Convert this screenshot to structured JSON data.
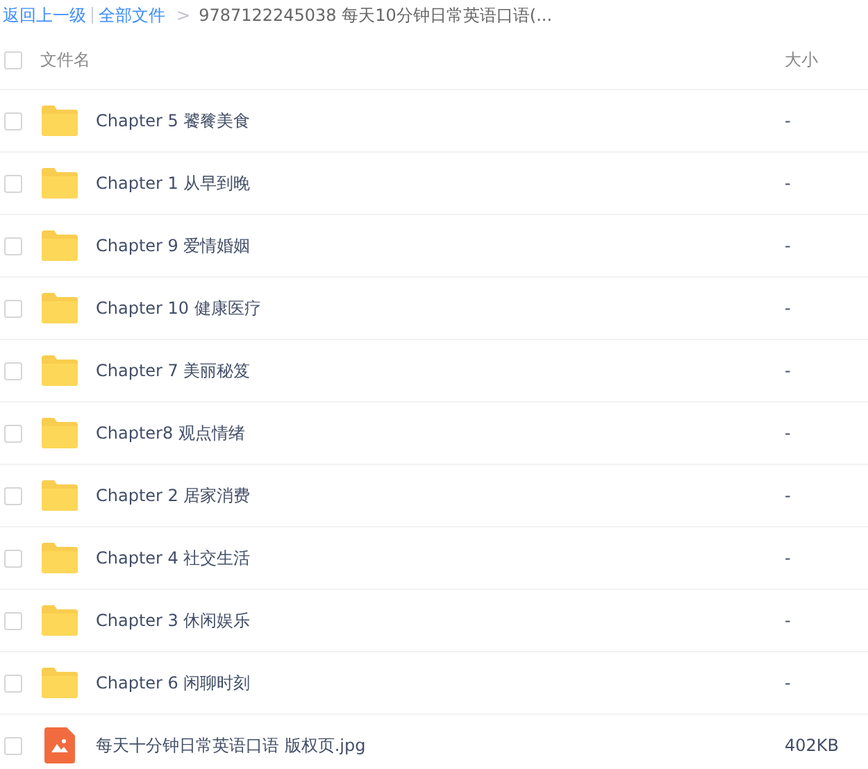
{
  "breadcrumb": {
    "back": "返回上一级",
    "root": "全部文件",
    "separator": ">",
    "current": "9787122245038 每天10分钟日常英语口语(..."
  },
  "header": {
    "name": "文件名",
    "size": "大小",
    "checked": false
  },
  "files": [
    {
      "kind": "folder",
      "name": "Chapter 5 饕餮美食",
      "size": "-",
      "checked": false
    },
    {
      "kind": "folder",
      "name": "Chapter 1 从早到晚",
      "size": "-",
      "checked": false
    },
    {
      "kind": "folder",
      "name": "Chapter 9 爱情婚姻",
      "size": "-",
      "checked": false
    },
    {
      "kind": "folder",
      "name": "Chapter 10 健康医疗",
      "size": "-",
      "checked": false
    },
    {
      "kind": "folder",
      "name": "Chapter 7 美丽秘笈",
      "size": "-",
      "checked": false
    },
    {
      "kind": "folder",
      "name": "Chapter8 观点情绪",
      "size": "-",
      "checked": false
    },
    {
      "kind": "folder",
      "name": "Chapter 2 居家消费",
      "size": "-",
      "checked": false
    },
    {
      "kind": "folder",
      "name": "Chapter 4 社交生活",
      "size": "-",
      "checked": false
    },
    {
      "kind": "folder",
      "name": "Chapter 3 休闲娱乐",
      "size": "-",
      "checked": false
    },
    {
      "kind": "folder",
      "name": "Chapter 6 闲聊时刻",
      "size": "-",
      "checked": false
    },
    {
      "kind": "image",
      "name": "每天十分钟日常英语口语 版权页.jpg",
      "size": "402KB",
      "checked": false
    }
  ]
}
